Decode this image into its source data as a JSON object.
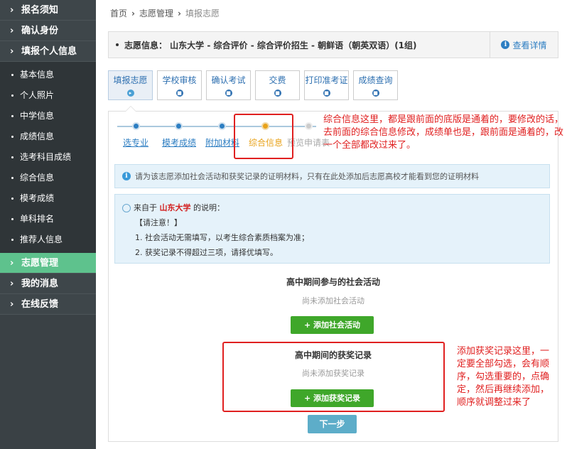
{
  "sidebar": {
    "top_items": [
      {
        "label": "报名须知"
      },
      {
        "label": "确认身份"
      },
      {
        "label": "填报个人信息"
      }
    ],
    "sub_items": [
      {
        "label": "基本信息"
      },
      {
        "label": "个人照片"
      },
      {
        "label": "中学信息"
      },
      {
        "label": "成绩信息"
      },
      {
        "label": "选考科目成绩"
      },
      {
        "label": "综合信息"
      },
      {
        "label": "模考成绩"
      },
      {
        "label": "单科排名"
      },
      {
        "label": "推荐人信息"
      }
    ],
    "bottom_items": [
      {
        "label": "志愿管理"
      },
      {
        "label": "我的消息"
      },
      {
        "label": "在线反馈"
      }
    ]
  },
  "breadcrumb": {
    "home": "首页",
    "level2": "志愿管理",
    "current": "填报志愿"
  },
  "infobar": {
    "text": "志愿信息： 山东大学 - 综合评价 - 综合评价招生 - 朝鲜语（朝英双语）(1组)",
    "detail_label": "查看详情"
  },
  "tabs": [
    {
      "label": "填报志愿"
    },
    {
      "label": "学校审核"
    },
    {
      "label": "确认考试"
    },
    {
      "label": "交费"
    },
    {
      "label": "打印准考证"
    },
    {
      "label": "成绩查询"
    }
  ],
  "substeps": [
    {
      "label": "选专业"
    },
    {
      "label": "模考成绩"
    },
    {
      "label": "附加材料"
    },
    {
      "label": "综合信息"
    },
    {
      "label": "预览申请表"
    }
  ],
  "notice": "请为该志愿添加社会活动和获奖记录的证明材料，只有在此处添加后志愿高校才能看到您的证明材料",
  "explain": {
    "prefix": "来自于",
    "school": "山东大学",
    "suffix": "的说明：",
    "line1": "【请注意！】",
    "line2": "1. 社会活动无需填写，以考生综合素质档案为准；",
    "line3": "2. 获奖记录不得超过三项，请择优填写。"
  },
  "social": {
    "title": "高中期间参与的社会活动",
    "empty": "尚未添加社会活动",
    "button": "+ 添加社会活动"
  },
  "awards": {
    "title": "高中期间的获奖记录",
    "empty": "尚未添加获奖记录",
    "button": "+ 添加获奖记录"
  },
  "next_button": "下一步",
  "annotations": {
    "top": "综合信息这里，都是跟前面的底版是通着的，要修改的话，去前面的综合信息修改，成绩单也是，跟前面是通着的，改一个全部都改过来了。",
    "right": "添加获奖记录这里，一定要全部勾选，会有顺序，勾选重要的，点确定，然后再继续添加，顺序就调整过来了"
  },
  "colors": {
    "sidebar": "#3a4145",
    "active": "#5ec28d",
    "link": "#2d7ec2",
    "green_button": "#3fa72a",
    "annotation": "#e02020"
  }
}
